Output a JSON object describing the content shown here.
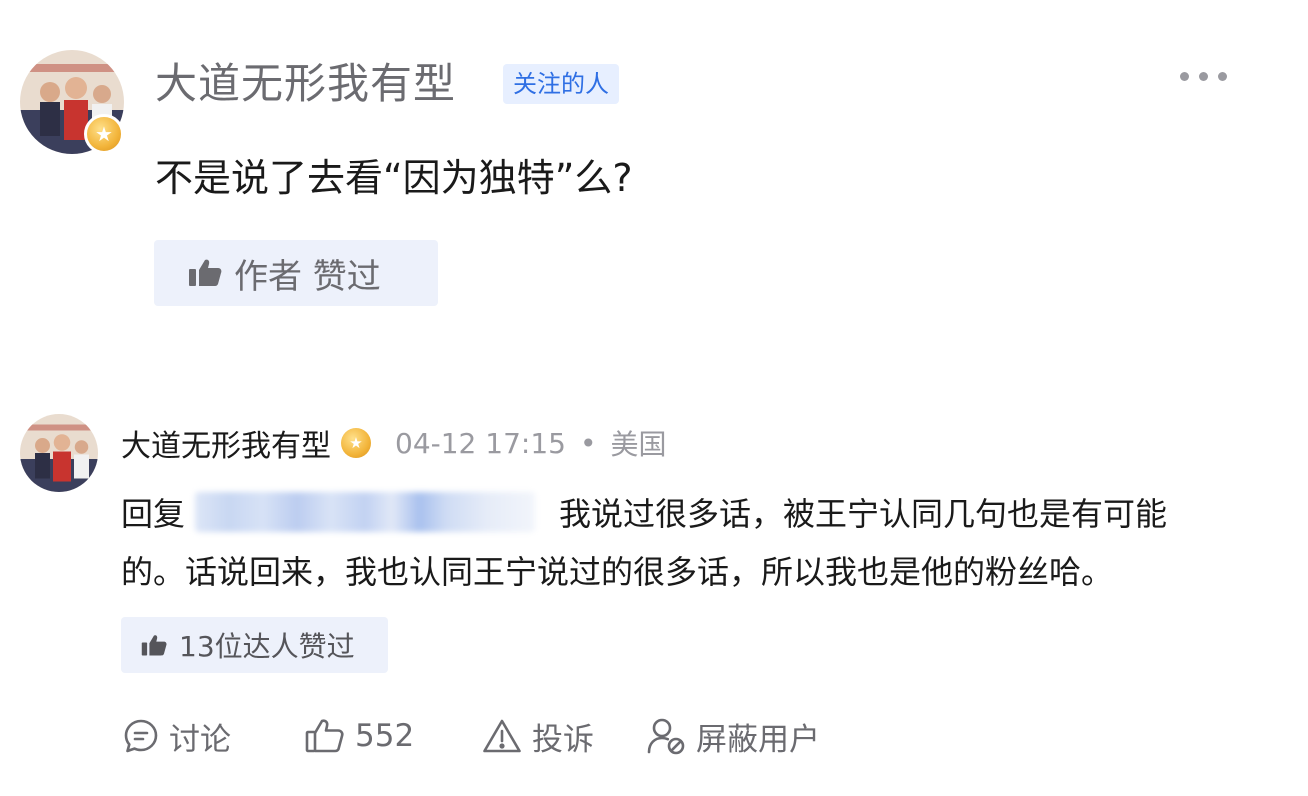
{
  "top_comment": {
    "username": "大道无形我有型",
    "follow_tag": "关注的人",
    "text": "不是说了去看“因为独特”么?",
    "author_liked_label": "作者 赞过",
    "more_icon": "more-horizontal-icon"
  },
  "reply": {
    "username": "大道无形我有型",
    "badge_icon": "gold-badge-icon",
    "time": "04-12 17:15",
    "separator": "•",
    "location": "美国",
    "reply_prefix": "回复",
    "line1_text": "我说过很多话，被王宁认同几句也是有可能",
    "line2_text": "的。话说回来，我也认同王宁说过的很多话，所以我也是他的粉丝哈。",
    "expert_liked_label": "13位达人赞过"
  },
  "actions": {
    "discuss": "讨论",
    "like_count": "552",
    "report": "投诉",
    "block": "屏蔽用户"
  },
  "colors": {
    "accent": "#2f6fe4",
    "tag_bg": "#e7efff",
    "chip_bg": "#edf1fb",
    "muted": "#9a9aa0",
    "text": "#1a1a1a"
  }
}
